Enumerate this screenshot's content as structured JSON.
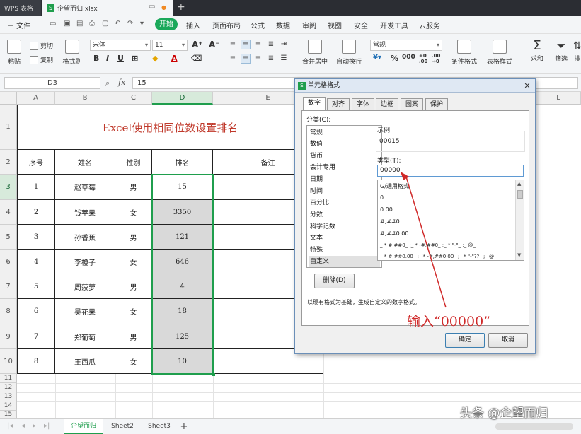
{
  "titlebar": {
    "app_name": "WPS 表格",
    "file_name": "企望而归.xlsx",
    "badge": "S",
    "window_ctl": "▭",
    "dot": "●",
    "new_tab": "+"
  },
  "menu": {
    "file": "三 文件",
    "start": "开始",
    "items": [
      "插入",
      "页面布局",
      "公式",
      "数据",
      "审阅",
      "视图",
      "安全",
      "开发工具",
      "云服务"
    ]
  },
  "ribbon": {
    "paste": "粘贴",
    "cut": "剪切",
    "copy": "复制",
    "format_painter": "格式刷",
    "font_name": "宋体",
    "font_size": "11",
    "number_format": "常规",
    "merge": "合并居中",
    "wrap": "自动换行",
    "cond_format": "条件格式",
    "table_style": "表格样式",
    "sum": "求和",
    "filter": "筛选",
    "sort": "排"
  },
  "formula_bar": {
    "name_box": "D3",
    "fx": "fx",
    "content": "15"
  },
  "sheet": {
    "columns": [
      "A",
      "B",
      "C",
      "D",
      "E",
      "F",
      "G",
      "H",
      "I",
      "J",
      "K",
      "L"
    ],
    "rows": [
      "1",
      "2",
      "3",
      "4",
      "5",
      "6",
      "7",
      "8",
      "9",
      "10",
      "11",
      "12",
      "13",
      "14",
      "15"
    ],
    "title": "Excel使用相同位数设置排名",
    "headers": [
      "序号",
      "姓名",
      "性别",
      "排名",
      "备注"
    ],
    "data": [
      [
        "1",
        "赵草莓",
        "男",
        "15"
      ],
      [
        "2",
        "钱苹果",
        "女",
        "3350"
      ],
      [
        "3",
        "孙香蕉",
        "男",
        "121"
      ],
      [
        "4",
        "李橙子",
        "女",
        "646"
      ],
      [
        "5",
        "周菠萝",
        "男",
        "4"
      ],
      [
        "6",
        "吴花果",
        "女",
        "18"
      ],
      [
        "7",
        "郑葡萄",
        "男",
        "125"
      ],
      [
        "8",
        "王西瓜",
        "女",
        "10"
      ]
    ],
    "active_cell": "D3"
  },
  "sheet_tabs": [
    "企望而归",
    "Sheet2",
    "Sheet3"
  ],
  "add_sheet": "+",
  "dialog": {
    "title": "单元格格式",
    "close": "✕",
    "tabs": [
      "数字",
      "对齐",
      "字体",
      "边框",
      "图案",
      "保护"
    ],
    "category_label": "分类(C):",
    "categories": [
      "常规",
      "数值",
      "货币",
      "会计专用",
      "日期",
      "时间",
      "百分比",
      "分数",
      "科学记数",
      "文本",
      "特殊",
      "自定义"
    ],
    "selected_category": "自定义",
    "sample_label": "示例",
    "sample_value": "00015",
    "type_label": "类型(T):",
    "type_value": "00000",
    "formats": [
      "G/通用格式",
      "0",
      "0.00",
      "#,##0",
      "#,##0.00",
      "_ * #,##0_ ;_ * -#,##0_ ;_ * \"-\"_ ;_ @_",
      "_ * #,##0.00_ ;_ * -#,##0.00_ ;_ * \"-\"??_ ;_ @_"
    ],
    "delete_btn": "删除(D)",
    "hint": "以现有格式为基础，生成自定义的数字格式。",
    "ok": "确定",
    "cancel": "取消"
  },
  "annotation": "输入“00000”",
  "watermark": "头条 @企望而归",
  "colors": {
    "accent_green": "#1f9e4d",
    "title_red": "#c0392b",
    "annotation_red": "#d02a2a",
    "gray_fill": "#d9d9d9"
  }
}
